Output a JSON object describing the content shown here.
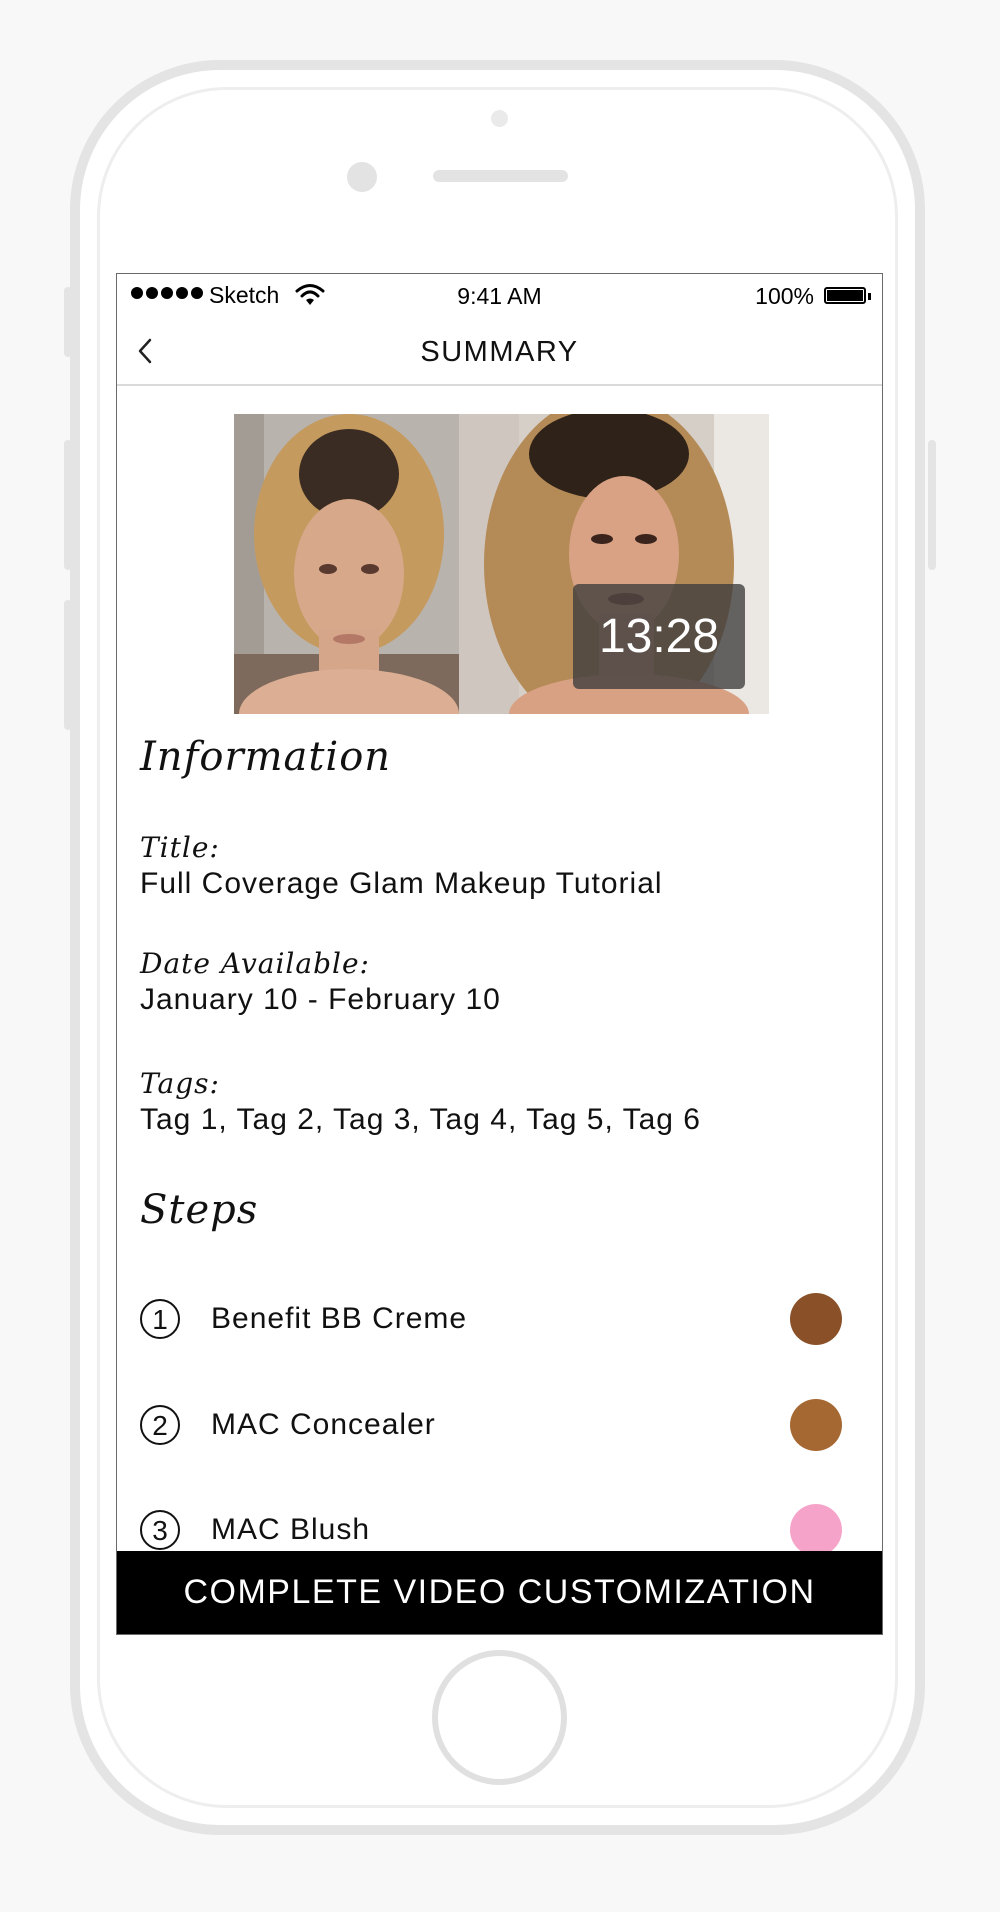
{
  "status_bar": {
    "carrier": "Sketch",
    "time": "9:41 AM",
    "battery": "100%"
  },
  "nav": {
    "title": "SUMMARY"
  },
  "video": {
    "duration": "13:28"
  },
  "information": {
    "heading": "Information",
    "title_label": "Title:",
    "title_value": "Full Coverage Glam Makeup Tutorial",
    "date_label": "Date Available:",
    "date_value": "January 10 - February 10",
    "tags_label": "Tags:",
    "tags_value": "Tag 1, Tag 2, Tag 3, Tag 4, Tag 5, Tag 6"
  },
  "steps": {
    "heading": "Steps",
    "items": [
      {
        "number": "1",
        "name": "Benefit BB Creme",
        "color": "#8a5129"
      },
      {
        "number": "2",
        "name": "MAC Concealer",
        "color": "#a56833"
      },
      {
        "number": "3",
        "name": "MAC Blush",
        "color": "#f6a3c9"
      }
    ]
  },
  "cta": {
    "label": "COMPLETE VIDEO CUSTOMIZATION"
  }
}
